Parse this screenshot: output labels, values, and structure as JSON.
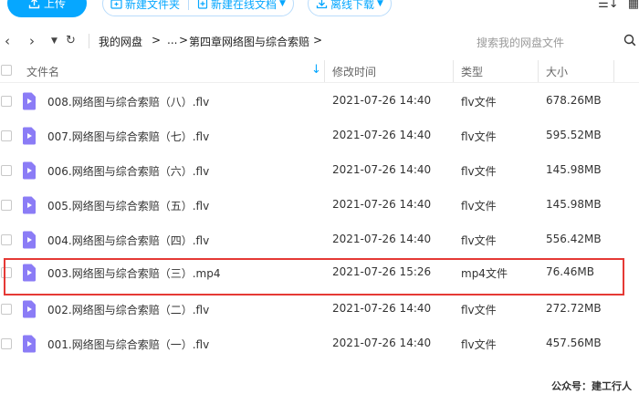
{
  "toolbar": {
    "upload_label": "上传",
    "new_folder_label": "新建文件夹",
    "new_online_doc_label": "新建在线文档",
    "offline_download_label": "离线下载"
  },
  "nav": {
    "crumbs": [
      "我的网盘",
      ">",
      "...",
      ">",
      "第四章网络图与综合索赔",
      ">"
    ],
    "search_placeholder": "搜索我的网盘文件"
  },
  "table": {
    "headers": [
      "文件名",
      "修改时间",
      "类型",
      "大小"
    ],
    "rows": [
      {
        "name": "008.网络图与综合索赔（八）.flv",
        "time": "2021-07-26 14:40",
        "type": "flv文件",
        "size": "678.26MB"
      },
      {
        "name": "007.网络图与综合索赔（七）.flv",
        "time": "2021-07-26 14:40",
        "type": "flv文件",
        "size": "595.52MB"
      },
      {
        "name": "006.网络图与综合索赔（六）.flv",
        "time": "2021-07-26 14:40",
        "type": "flv文件",
        "size": "145.98MB"
      },
      {
        "name": "005.网络图与综合索赔（五）.flv",
        "time": "2021-07-26 14:40",
        "type": "flv文件",
        "size": "145.98MB"
      },
      {
        "name": "004.网络图与综合索赔（四）.flv",
        "time": "2021-07-26 14:40",
        "type": "flv文件",
        "size": "556.42MB"
      },
      {
        "name": "003.网络图与综合索赔（三）.mp4",
        "time": "2021-07-26 15:26",
        "type": "mp4文件",
        "size": "76.46MB"
      },
      {
        "name": "002.网络图与综合索赔（二）.flv",
        "time": "2021-07-26 14:40",
        "type": "flv文件",
        "size": "272.72MB"
      },
      {
        "name": "001.网络图与综合索赔（一）.flv",
        "time": "2021-07-26 14:40",
        "type": "flv文件",
        "size": "457.56MB"
      }
    ]
  },
  "watermark": "公众号：建工行人",
  "colors": {
    "accent": "#06a7ff",
    "video_icon": "#8b7cf6",
    "highlight_border": "#e53935"
  }
}
